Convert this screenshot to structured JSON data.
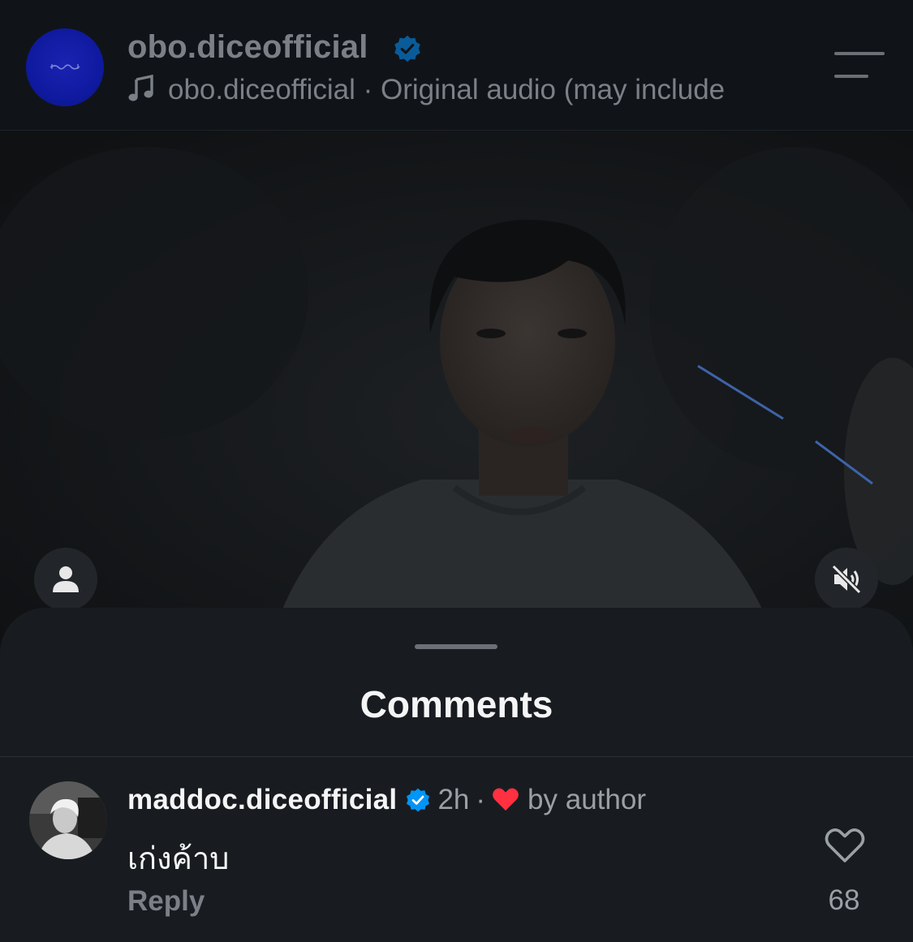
{
  "header": {
    "username": "obo.diceofficial",
    "audio_user": "obo.diceofficial",
    "separator": "·",
    "audio_label": "Original audio",
    "audio_suffix": "(may include"
  },
  "video": {
    "user_tag_icon": "person-icon",
    "mute_icon": "speaker-muted-icon"
  },
  "comments": {
    "title": "Comments",
    "items": [
      {
        "username": "maddoc.diceofficial",
        "time": "2h",
        "dot": "·",
        "liked_by": "by author",
        "text": "เก่งค้าบ",
        "reply_label": "Reply",
        "like_count": "68"
      }
    ]
  },
  "colors": {
    "background": "#0c1014",
    "sheet": "#181c20",
    "verified": "#0095f6",
    "heart": "#ff3040",
    "muted_text": "#7b8088"
  }
}
